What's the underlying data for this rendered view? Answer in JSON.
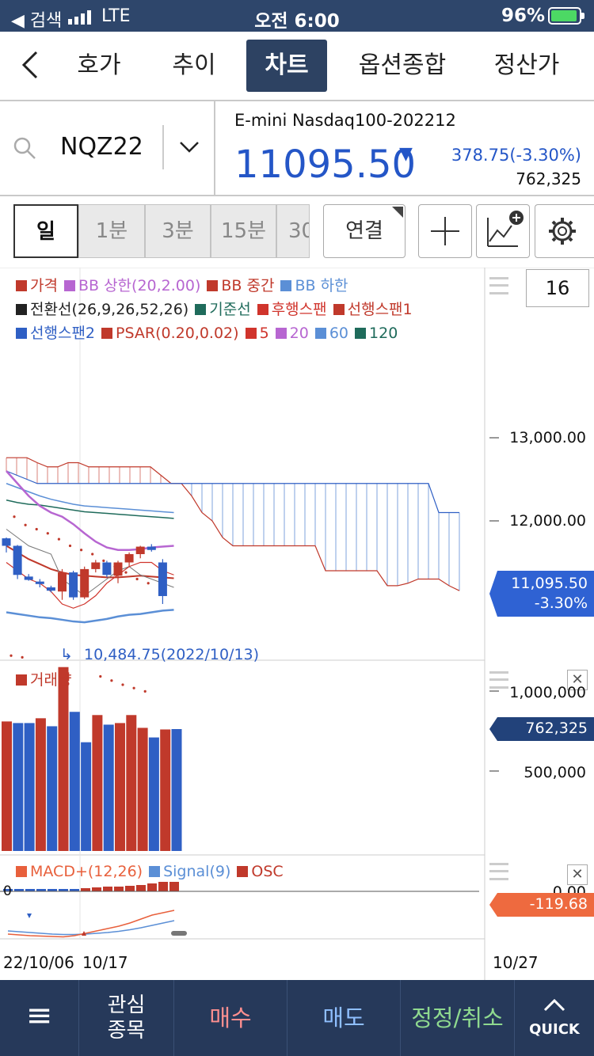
{
  "status_bar": {
    "carrier": "◀ 검색",
    "network": "LTE",
    "time": "오전 6:00",
    "battery": "96%"
  },
  "nav": {
    "tabs": [
      "호가",
      "추이",
      "차트",
      "옵션종합",
      "정산가"
    ],
    "active": "차트"
  },
  "symbol": {
    "code": "NQZ22",
    "name": "E-mini Nasdaq100-202212",
    "price": "11095.50",
    "direction": "▼",
    "change": "378.75(-3.30%)",
    "volume": "762,325"
  },
  "intervals": [
    "일",
    "1분",
    "3분",
    "15분",
    "30"
  ],
  "link_button": "연결",
  "legend": {
    "row1": [
      {
        "t": "가격",
        "c": "#c0392b"
      },
      {
        "t": "BB 상한(20,2.00)",
        "c": "#b766d1"
      },
      {
        "t": "BB 중간",
        "c": "#c0392b"
      },
      {
        "t": "BB 하한",
        "c": "#5b8fd6"
      }
    ],
    "row2": [
      {
        "t": "전환선(26,9,26,52,26)",
        "c": "#222222"
      },
      {
        "t": "기준선",
        "c": "#1f6b5b"
      },
      {
        "t": "후행스팬",
        "c": "#d0342c"
      },
      {
        "t": "선행스팬1",
        "c": "#c0392b"
      }
    ],
    "row3": [
      {
        "t": "선행스팬2",
        "c": "#2f5fc4"
      },
      {
        "t": "PSAR(0.20,0.02)",
        "c": "#c0392b"
      },
      {
        "t": "5",
        "c": "#d0342c"
      },
      {
        "t": "20",
        "c": "#b766d1"
      },
      {
        "t": "60",
        "c": "#5b8fd6"
      },
      {
        "t": "120",
        "c": "#1f6b5b"
      }
    ]
  },
  "visible_bars": "16",
  "price_axis": {
    "ticks": [
      "13,000.00",
      "12,000.00"
    ],
    "current_label": "11,095.50",
    "current_change": "-3.30%"
  },
  "low_marker": "10,484.75(2022/10/13)",
  "volume_panel": {
    "title": "거래량",
    "ticks": [
      "1,000,000",
      "500,000"
    ],
    "current": "762,325"
  },
  "macd_panel": {
    "titles": [
      {
        "t": "MACD+(12,26)",
        "c": "#e8603c"
      },
      {
        "t": "Signal(9)",
        "c": "#5b8fd6"
      },
      {
        "t": "OSC",
        "c": "#c0392b"
      }
    ],
    "zero_label": "0",
    "axis_tick": "0.00",
    "current": "-119.68"
  },
  "date_axis": [
    "22/10/06",
    "10/17",
    "10/27"
  ],
  "bottom_bar": {
    "menu": "≡",
    "interest": "관심\n종목",
    "buy": "매수",
    "sell": "매도",
    "modify": "정정/취소",
    "quick": "QUICK"
  },
  "chart_data": [
    {
      "type": "candlestick",
      "title": "",
      "series": [
        {
          "name": "가격",
          "date_labels": [
            "22/10/06",
            "10/17",
            "10/27"
          ],
          "ohlc": [
            [
              11790,
              11800,
              11620,
              11700
            ],
            [
              11700,
              11710,
              11300,
              11350
            ],
            [
              11330,
              11360,
              11280,
              11290
            ],
            [
              11270,
              11300,
              11200,
              11240
            ],
            [
              11200,
              11220,
              11140,
              11160
            ],
            [
              11150,
              11420,
              11050,
              11380
            ],
            [
              11380,
              11400,
              11050,
              11080
            ],
            [
              11080,
              11450,
              11060,
              11420
            ],
            [
              11420,
              11530,
              11380,
              11500
            ],
            [
              11500,
              11520,
              11320,
              11350
            ],
            [
              11340,
              11520,
              11250,
              11500
            ],
            [
              11500,
              11620,
              11450,
              11600
            ],
            [
              11600,
              11700,
              11550,
              11690
            ],
            [
              11690,
              11720,
              11630,
              11650
            ],
            [
              11500,
              11540,
              11000,
              11095.5
            ]
          ]
        }
      ],
      "ylim": [
        10400,
        13400
      ],
      "y_ticks": [
        13000,
        12000
      ]
    },
    {
      "type": "bar",
      "title": "거래량",
      "values": [
        810000,
        800000,
        800000,
        830000,
        780000,
        1150000,
        870000,
        680000,
        850000,
        790000,
        800000,
        850000,
        770000,
        710000,
        760000,
        762325
      ],
      "ylim": [
        0,
        1150000
      ]
    },
    {
      "type": "line",
      "title": "MACD",
      "series": [
        {
          "name": "MACD+(12,26)",
          "values": [
            -420,
            -430,
            -440,
            -445,
            -450,
            -455,
            -440,
            -410,
            -380,
            -350,
            -320,
            -280,
            -230,
            -180,
            -150,
            -119.68
          ]
        },
        {
          "name": "Signal(9)",
          "values": [
            -380,
            -390,
            -400,
            -410,
            -420,
            -425,
            -425,
            -420,
            -410,
            -400,
            -385,
            -365,
            -340,
            -310,
            -280,
            -250
          ]
        }
      ]
    }
  ]
}
